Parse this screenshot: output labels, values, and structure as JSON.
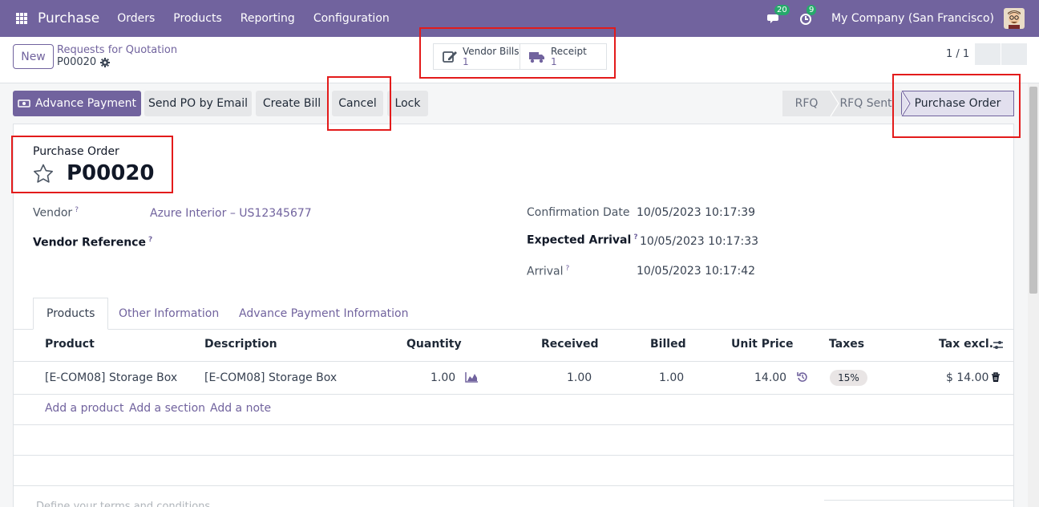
{
  "navbar": {
    "app_name": "Purchase",
    "menu": [
      "Orders",
      "Products",
      "Reporting",
      "Configuration"
    ],
    "messages_count": "20",
    "activities_count": "9",
    "company": "My Company (San Francisco)"
  },
  "control": {
    "new_label": "New",
    "breadcrumb_parent": "Requests for Quotation",
    "breadcrumb_current": "P00020",
    "smart_buttons": [
      {
        "label": "Vendor Bills",
        "value": "1",
        "icon": "edit-icon"
      },
      {
        "label": "Receipt",
        "value": "1",
        "icon": "truck-icon"
      }
    ],
    "pager": "1 / 1"
  },
  "actions": {
    "advance_payment": "Advance Payment",
    "send_po": "Send PO by Email",
    "create_bill": "Create Bill",
    "cancel": "Cancel",
    "lock": "Lock"
  },
  "status": [
    "RFQ",
    "RFQ Sent",
    "Purchase Order"
  ],
  "form": {
    "title_label": "Purchase Order",
    "name": "P00020",
    "vendor_label": "Vendor",
    "vendor_value": "Azure Interior – US12345677",
    "vendor_ref_label": "Vendor Reference",
    "confirmation_date_label": "Confirmation Date",
    "confirmation_date_value": "10/05/2023 10:17:39",
    "expected_arrival_label": "Expected Arrival",
    "expected_arrival_value": "10/05/2023 10:17:33",
    "arrival_label": "Arrival",
    "arrival_value": "10/05/2023 10:17:42"
  },
  "tabs": [
    "Products",
    "Other Information",
    "Advance Payment Information"
  ],
  "table": {
    "columns": [
      "Product",
      "Description",
      "Quantity",
      "Received",
      "Billed",
      "Unit Price",
      "Taxes",
      "Tax excl."
    ],
    "rows": [
      {
        "product": "[E-COM08] Storage Box",
        "description": "[E-COM08] Storage Box",
        "quantity": "1.00",
        "received": "1.00",
        "billed": "1.00",
        "unit_price": "14.00",
        "taxes": "15%",
        "subtotal": "$ 14.00"
      }
    ],
    "add_links": [
      "Add a product",
      "Add a section",
      "Add a note"
    ]
  },
  "terms_placeholder": "Define your terms and conditions ..."
}
